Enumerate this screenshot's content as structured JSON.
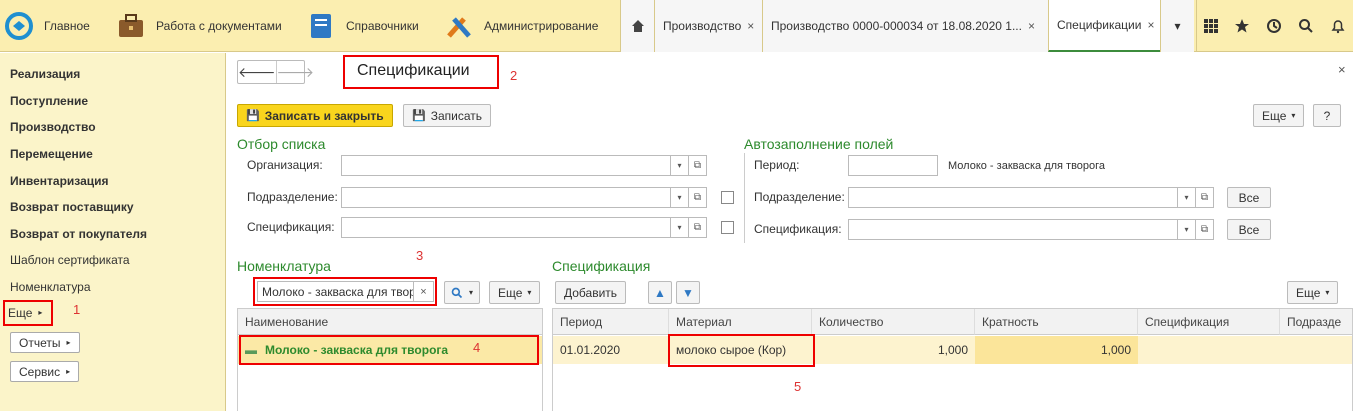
{
  "topbar": {
    "sections": [
      {
        "label": "Главное",
        "icon": "logo-icon"
      },
      {
        "label": "Работа с документами",
        "icon": "briefcase-icon"
      },
      {
        "label": "Справочники",
        "icon": "book-icon"
      },
      {
        "label": "Администрирование",
        "icon": "tools-icon"
      }
    ],
    "tabs": [
      {
        "label": "Производство"
      },
      {
        "label": "Производство 0000-000034 от 18.08.2020 1..."
      },
      {
        "label": "Спецификации"
      }
    ],
    "close_glyph": "×",
    "more_glyph": "▾"
  },
  "sidebar": {
    "items": [
      "Реализация",
      "Поступление",
      "Производство",
      "Перемещение",
      "Инвентаризация",
      "Возврат поставщику",
      "Возврат от покупателя",
      "Шаблон сертификата",
      "Номенклатура"
    ],
    "more": "Еще",
    "reports": "Отчеты",
    "service": "Сервис"
  },
  "form": {
    "title": "Спецификации",
    "close": "×",
    "save_close": "Записать и закрыть",
    "save": "Записать",
    "more": "Еще",
    "help": "?"
  },
  "filter": {
    "title": "Отбор списка",
    "org_label": "Организация:",
    "dept_label": "Подразделение:",
    "spec_label": "Спецификация:"
  },
  "autofill": {
    "title": "Автозаполнение полей",
    "period_label": "Период:",
    "period_value": "",
    "nomen_text": "Молоко - закваска для творога",
    "dept_label": "Подразделение:",
    "spec_label": "Спецификация:",
    "all": "Все"
  },
  "nomenclature": {
    "title": "Номенклатура",
    "search_value": "Молоко - закваска для твор",
    "clear": "×",
    "more": "Еще",
    "column": "Наименование",
    "row": "Молоко - закваска для творога"
  },
  "specification": {
    "title": "Спецификация",
    "add": "Добавить",
    "more": "Еще",
    "columns": [
      "Период",
      "Материал",
      "Количество",
      "Кратность",
      "Спецификация",
      "Подразде"
    ],
    "rows": [
      {
        "period": "01.01.2020",
        "material": "молоко сырое (Кор)",
        "quantity": "1,000",
        "multiplicity": "1,000",
        "spec": "",
        "dept": ""
      }
    ]
  },
  "annotations": [
    "1",
    "2",
    "3",
    "4",
    "5"
  ],
  "colors": {
    "topbar": "#fbeeb0",
    "sidebar": "#fbf4c9",
    "section_title": "#2d8a2d",
    "primary_button": "#f9d51d",
    "selected_row": "#fbe9a6",
    "annotation": "#e00000"
  }
}
